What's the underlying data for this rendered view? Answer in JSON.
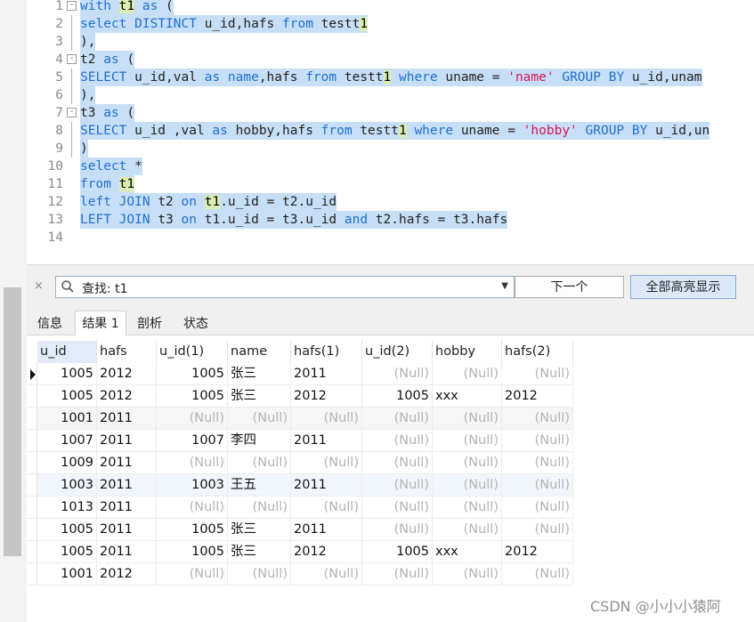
{
  "editor": {
    "lines": [
      {
        "n": "1",
        "fold": "-",
        "tokens": [
          [
            "kw",
            "with "
          ],
          [
            "hl",
            "t1"
          ],
          [
            "kw",
            " as "
          ],
          [
            "tx",
            "("
          ]
        ]
      },
      {
        "n": "2",
        "tokens": [
          [
            "tx",
            "  "
          ],
          [
            "kw",
            "select "
          ],
          [
            "kw",
            "DISTINCT "
          ],
          [
            "tx",
            "u_id,hafs "
          ],
          [
            "kw",
            "from "
          ],
          [
            "tx",
            "testt"
          ],
          [
            "hl",
            "1"
          ]
        ]
      },
      {
        "n": "3",
        "tokens": [
          [
            "tx",
            "),"
          ]
        ]
      },
      {
        "n": "4",
        "fold": "-",
        "tokens": [
          [
            "tx",
            "t2 "
          ],
          [
            "kw",
            "as "
          ],
          [
            "tx",
            "("
          ]
        ]
      },
      {
        "n": "5",
        "tokens": [
          [
            "tx",
            "  "
          ],
          [
            "kw",
            "SELECT "
          ],
          [
            "tx",
            "u_id,val "
          ],
          [
            "kw",
            "as "
          ],
          [
            "kw",
            "name"
          ],
          [
            "tx",
            ",hafs   "
          ],
          [
            "kw",
            "from "
          ],
          [
            "tx",
            "testt"
          ],
          [
            "hl",
            "1"
          ],
          [
            "tx",
            " "
          ],
          [
            "kw",
            "where "
          ],
          [
            "tx",
            "uname = "
          ],
          [
            "str",
            "'name'"
          ],
          [
            "tx",
            " "
          ],
          [
            "kw",
            "GROUP BY "
          ],
          [
            "tx",
            "u_id,unam"
          ]
        ]
      },
      {
        "n": "6",
        "tokens": [
          [
            "tx",
            "),"
          ]
        ]
      },
      {
        "n": "7",
        "fold": "-",
        "tokens": [
          [
            "tx",
            "t3 "
          ],
          [
            "kw",
            "as "
          ],
          [
            "tx",
            "("
          ]
        ]
      },
      {
        "n": "8",
        "tokens": [
          [
            "tx",
            "  "
          ],
          [
            "kw",
            "SELECT "
          ],
          [
            "tx",
            "u_id ,val "
          ],
          [
            "kw",
            "as "
          ],
          [
            "tx",
            "hobby,hafs  "
          ],
          [
            "kw",
            "from "
          ],
          [
            "tx",
            "testt"
          ],
          [
            "hl",
            "1"
          ],
          [
            "tx",
            " "
          ],
          [
            "kw",
            "where "
          ],
          [
            "tx",
            "uname = "
          ],
          [
            "str",
            "'hobby'"
          ],
          [
            "tx",
            " "
          ],
          [
            "kw",
            "GROUP BY "
          ],
          [
            "tx",
            "u_id,un"
          ]
        ]
      },
      {
        "n": "9",
        "tokens": [
          [
            "tx",
            ")"
          ]
        ]
      },
      {
        "n": "10",
        "tokens": [
          [
            "kw",
            "select "
          ],
          [
            "tx",
            "*"
          ]
        ]
      },
      {
        "n": "11",
        "tokens": [
          [
            "kw",
            "from "
          ],
          [
            "hl",
            "t1"
          ]
        ]
      },
      {
        "n": "12",
        "tokens": [
          [
            "kw",
            "left "
          ],
          [
            "kw",
            "JOIN "
          ],
          [
            "tx",
            "t2 "
          ],
          [
            "kw",
            "on "
          ],
          [
            "hl",
            "t1"
          ],
          [
            "tx",
            ".u_id = t2.u_id"
          ]
        ]
      },
      {
        "n": "13",
        "tokens": [
          [
            "kw",
            "LEFT "
          ],
          [
            "kw",
            "JOIN "
          ],
          [
            "tx",
            "t3 "
          ],
          [
            "kw",
            "on "
          ],
          [
            "tx",
            "t1.u_id = t3.u_id "
          ],
          [
            "kw",
            "and "
          ],
          [
            "tx",
            "t2.hafs = t3.hafs"
          ]
        ]
      },
      {
        "n": "14",
        "tokens": []
      }
    ]
  },
  "find": {
    "close": "×",
    "value": "查找: t1",
    "dropdown": "▼",
    "next_label": "下一个",
    "highlight_all_label": "全部高亮显示"
  },
  "tabs": [
    "信息",
    "结果 1",
    "剖析",
    "状态"
  ],
  "active_tab": 1,
  "grid": {
    "columns": [
      "u_id",
      "hafs",
      "u_id(1)",
      "name",
      "hafs(1)",
      "u_id(2)",
      "hobby",
      "hafs(2)"
    ],
    "rows": [
      [
        "1005",
        "2012",
        "1005",
        "张三",
        "2011",
        "(Null)",
        "(Null)",
        "(Null)"
      ],
      [
        "1005",
        "2012",
        "1005",
        "张三",
        "2012",
        "1005",
        "xxx",
        "2012"
      ],
      [
        "1001",
        "2011",
        "(Null)",
        "(Null)",
        "(Null)",
        "(Null)",
        "(Null)",
        "(Null)"
      ],
      [
        "1007",
        "2011",
        "1007",
        "李四",
        "2011",
        "(Null)",
        "(Null)",
        "(Null)"
      ],
      [
        "1009",
        "2011",
        "(Null)",
        "(Null)",
        "(Null)",
        "(Null)",
        "(Null)",
        "(Null)"
      ],
      [
        "1003",
        "2011",
        "1003",
        "王五",
        "2011",
        "(Null)",
        "(Null)",
        "(Null)"
      ],
      [
        "1013",
        "2011",
        "(Null)",
        "(Null)",
        "(Null)",
        "(Null)",
        "(Null)",
        "(Null)"
      ],
      [
        "1005",
        "2011",
        "1005",
        "张三",
        "2011",
        "(Null)",
        "(Null)",
        "(Null)"
      ],
      [
        "1005",
        "2011",
        "1005",
        "张三",
        "2012",
        "1005",
        "xxx",
        "2012"
      ],
      [
        "1001",
        "2012",
        "(Null)",
        "(Null)",
        "(Null)",
        "(Null)",
        "(Null)",
        "(Null)"
      ]
    ]
  },
  "watermark": "CSDN @小小小猿阿",
  "icons": {
    "search": "search-icon",
    "close": "close-icon",
    "dropdown": "chevron-down-icon",
    "row_pointer": "row-pointer-icon"
  }
}
